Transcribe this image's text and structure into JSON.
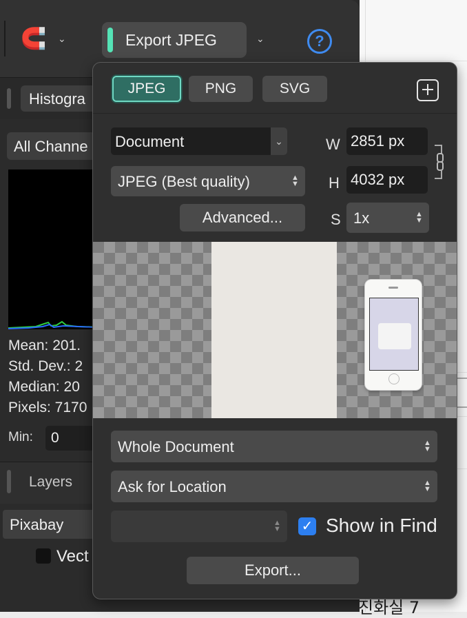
{
  "toolbar": {
    "export_persona_label": "Export JPEG",
    "help_glyph": "?"
  },
  "side_panel": {
    "histogram_tab": "Histogra",
    "channel_select": "All Channe",
    "stats": [
      "Mean: 201.",
      "Std. Dev.: 2",
      "Median: 20",
      "Pixels: 7170"
    ],
    "min_label": "Min:",
    "min_value": "0",
    "layers_label": "Layers",
    "layer_name": "Pixabay",
    "vector_label": "Vect"
  },
  "background_doc": {
    "korean_text": "진화실 7"
  },
  "export_popover": {
    "formats": [
      {
        "label": "JPEG",
        "active": true
      },
      {
        "label": "PNG",
        "active": false
      },
      {
        "label": "SVG",
        "active": false
      }
    ],
    "add_preset_icon": "plus-square-icon",
    "area": "Document",
    "preset": "JPEG (Best quality)",
    "advanced_label": "Advanced...",
    "width_label": "W",
    "width_value": "2851 px",
    "height_label": "H",
    "height_value": "4032 px",
    "scale_label": "S",
    "scale_value": "1x",
    "export_scope": "Whole Document",
    "location": "Ask for Location",
    "empty_select": "",
    "show_in_finder_label": "Show in Find",
    "show_in_finder_checked": true,
    "export_button": "Export..."
  },
  "colors": {
    "accent_teal": "#55e3b6",
    "help_blue": "#3f8bf0",
    "checkbox_blue": "#2d7ff0"
  }
}
